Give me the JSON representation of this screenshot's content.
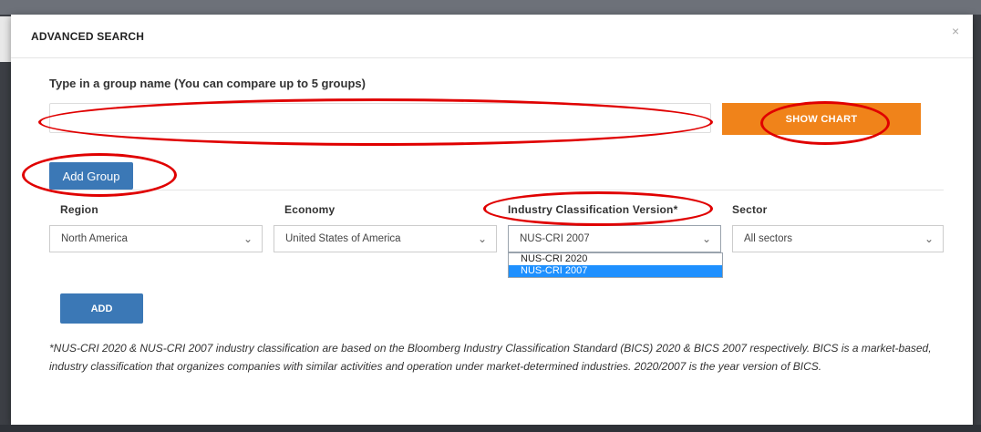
{
  "modal": {
    "title": "ADVANCED SEARCH",
    "close_glyph": "×"
  },
  "group": {
    "label": "Type in a group name (You can compare up to 5 groups)",
    "input_value": "",
    "input_placeholder": "",
    "show_chart_label": "SHOW CHART",
    "add_group_label": "Add Group"
  },
  "filters": {
    "region": {
      "label": "Region",
      "value": "North America"
    },
    "economy": {
      "label": "Economy",
      "value": "United States of America"
    },
    "industry": {
      "label": "Industry Classification Version*",
      "value": "NUS-CRI 2007",
      "options": [
        "NUS-CRI 2020",
        "NUS-CRI 2007"
      ],
      "selected_option": "NUS-CRI 2007"
    },
    "sector": {
      "label": "Sector",
      "value": "All sectors"
    }
  },
  "add_label": "ADD",
  "footnote": "*NUS-CRI 2020 & NUS-CRI 2007 industry classification are based on the Bloomberg Industry Classification Standard (BICS) 2020 & BICS 2007 respectively. BICS is a market-based, industry classification that organizes companies with similar activities and operation under market-determined industries. 2020/2007 is the year version of BICS.",
  "icons": {
    "chevron": "chevron-down-icon",
    "close": "close-icon"
  },
  "colors": {
    "primary": "#3b78b6",
    "accent": "#f0831a",
    "annotation": "#e00000",
    "dropdown_highlight": "#1e90ff"
  }
}
